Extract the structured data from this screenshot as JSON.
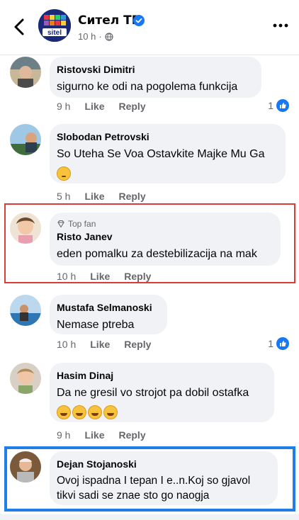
{
  "header": {
    "page_name": "Ситeл ТВ",
    "time": "10 h",
    "separator": "·",
    "avatar_text": "sitel"
  },
  "comments": [
    {
      "author": "Ristovski Dimitri",
      "text": "sigurno ke odi na pogolema funkcija",
      "time": "9 h",
      "like_label": "Like",
      "reply_label": "Reply",
      "like_count": "1"
    },
    {
      "author": "Slobodan Petrovski",
      "text": "So Uteha Se Voa Ostavkite Majke Mu Ga",
      "emoji": [
        "thinking-face"
      ],
      "time": "5 h",
      "like_label": "Like",
      "reply_label": "Reply"
    },
    {
      "badge": "Top fan",
      "author": "Risto Janev",
      "text": "eden pomalku za destebilizacija na mak",
      "time": "10 h",
      "like_label": "Like",
      "reply_label": "Reply",
      "highlight_color": "#d93a3a"
    },
    {
      "author": "Mustafa Selmanoski",
      "text": "Nemase ptreba",
      "time": "10 h",
      "like_label": "Like",
      "reply_label": "Reply",
      "like_count": "1"
    },
    {
      "author": "Hasim Dinaj",
      "text": "Da ne gresil vo strojot pa dobil ostafka",
      "emoji": [
        "grinning-face",
        "grinning-face",
        "grinning-face",
        "grinning-face"
      ],
      "time": "9 h",
      "like_label": "Like",
      "reply_label": "Reply"
    },
    {
      "author": "Dejan Stojanoski",
      "text_line1": "Ovoj ispadna I tepan I e..n.Koj so gjavol",
      "text_line2": "tikvi sadi se znae sto go naogja",
      "highlight_color": "#1f7ee8"
    }
  ],
  "colors": {
    "bubble": "#f0f2f5",
    "facebook_blue": "#1877f2",
    "muted": "#65676b"
  }
}
